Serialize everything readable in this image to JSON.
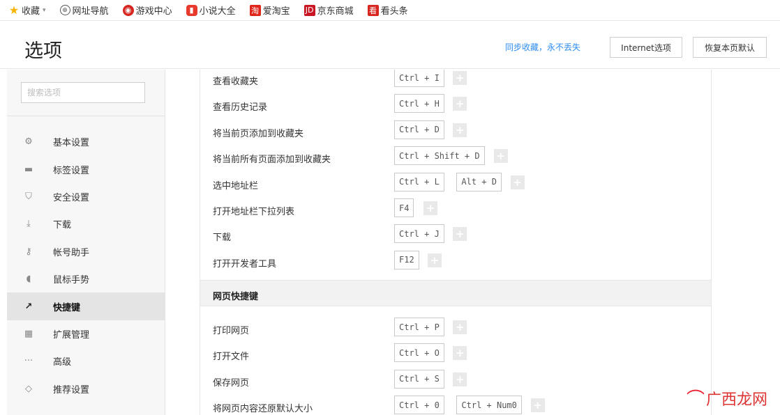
{
  "favorites": [
    {
      "label": "收藏",
      "icon": "star-icon",
      "glyph": "★",
      "cls": "ico-star",
      "caret": "▾"
    },
    {
      "label": "网址导航",
      "icon": "globe-icon",
      "glyph": "⊕",
      "cls": "ico-globe"
    },
    {
      "label": "游戏中心",
      "icon": "game-center-icon",
      "glyph": "◉",
      "cls": "ico-game"
    },
    {
      "label": "小说大全",
      "icon": "novel-icon",
      "glyph": "▮",
      "cls": "ico-novel"
    },
    {
      "label": "爱淘宝",
      "icon": "taobao-icon",
      "glyph": "淘",
      "cls": "ico-taobao"
    },
    {
      "label": "京东商城",
      "icon": "jd-icon",
      "glyph": "JD",
      "cls": "ico-jd"
    },
    {
      "label": "看头条",
      "icon": "news-icon",
      "glyph": "看",
      "cls": "ico-news"
    }
  ],
  "header": {
    "title": "选项",
    "sync_link": "同步收藏，永不丢失",
    "internet_options": "Internet选项",
    "restore_default": "恢复本页默认"
  },
  "sidebar": {
    "search_placeholder": "搜索选项",
    "items": [
      {
        "label": "基本设置",
        "icon": "gear-icon",
        "glyph": "⚙",
        "active": false
      },
      {
        "label": "标签设置",
        "icon": "tab-icon",
        "glyph": "▬",
        "active": false
      },
      {
        "label": "安全设置",
        "icon": "shield-check-icon",
        "glyph": "⛉",
        "active": false
      },
      {
        "label": "下载",
        "icon": "download-icon",
        "glyph": "⤓",
        "active": false
      },
      {
        "label": "帐号助手",
        "icon": "key-icon",
        "glyph": "⚷",
        "active": false
      },
      {
        "label": "鼠标手势",
        "icon": "mouse-icon",
        "glyph": "◖",
        "active": false
      },
      {
        "label": "快捷键",
        "icon": "shortcut-arrow-icon",
        "glyph": "↗",
        "active": true
      },
      {
        "label": "扩展管理",
        "icon": "extension-grid-icon",
        "glyph": "▦",
        "active": false
      },
      {
        "label": "高级",
        "icon": "more-dots-icon",
        "glyph": "···",
        "active": false
      },
      {
        "label": "推荐设置",
        "icon": "diamond-icon",
        "glyph": "◇",
        "active": false
      }
    ]
  },
  "shortcuts": {
    "add_glyph": "+",
    "browser_rows": [
      {
        "label": "查看收藏夹",
        "keys": [
          "Ctrl + I"
        ]
      },
      {
        "label": "查看历史记录",
        "keys": [
          "Ctrl + H"
        ]
      },
      {
        "label": "将当前页添加到收藏夹",
        "keys": [
          "Ctrl + D"
        ]
      },
      {
        "label": "将当前所有页面添加到收藏夹",
        "keys": [
          "Ctrl + Shift + D"
        ]
      },
      {
        "label": "选中地址栏",
        "keys": [
          "Ctrl + L",
          "Alt + D"
        ]
      },
      {
        "label": "打开地址栏下拉列表",
        "keys": [
          "F4"
        ]
      },
      {
        "label": "下载",
        "keys": [
          "Ctrl + J"
        ]
      },
      {
        "label": "打开开发者工具",
        "keys": [
          "F12"
        ]
      }
    ],
    "web_section_title": "网页快捷键",
    "web_rows": [
      {
        "label": "打印网页",
        "keys": [
          "Ctrl + P"
        ]
      },
      {
        "label": "打开文件",
        "keys": [
          "Ctrl + O"
        ]
      },
      {
        "label": "保存网页",
        "keys": [
          "Ctrl + S"
        ]
      },
      {
        "label": "将网页内容还原默认大小",
        "keys": [
          "Ctrl + 0",
          "Ctrl + Num0"
        ]
      }
    ]
  },
  "watermark": {
    "text": "广西龙网",
    "icon": "watermark-logo-icon"
  }
}
